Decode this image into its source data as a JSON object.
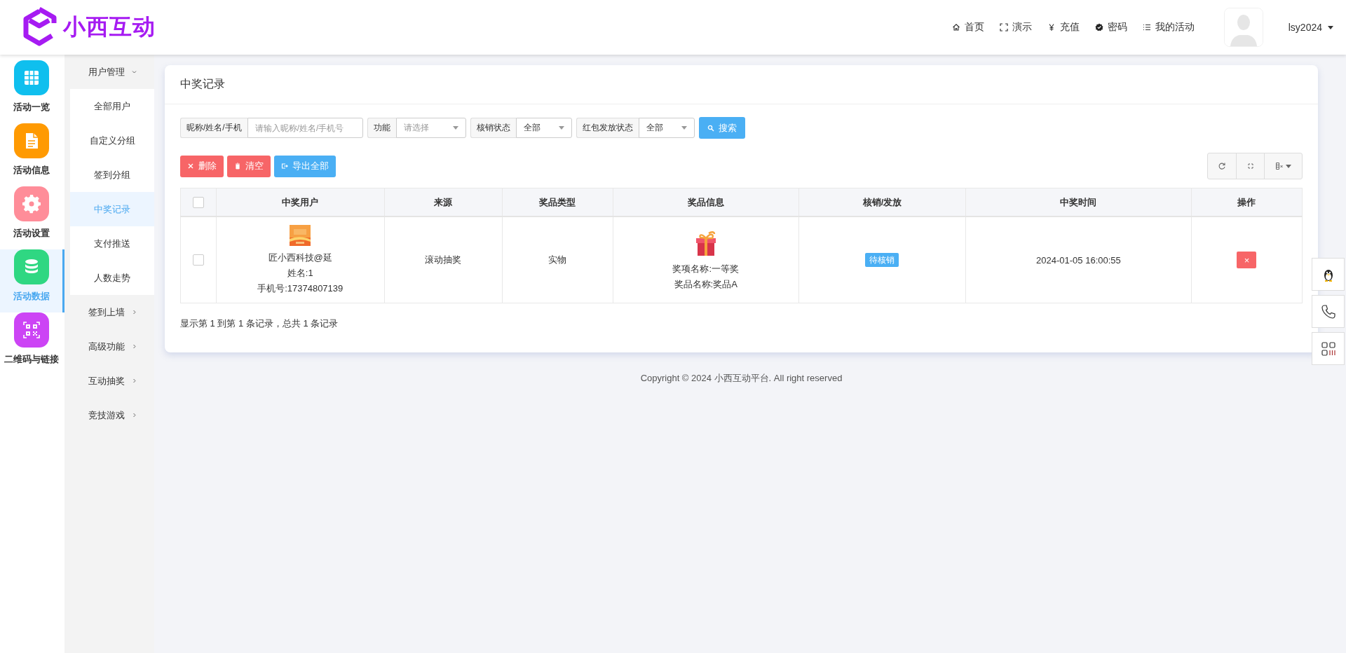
{
  "logo": {
    "text": "小西互动"
  },
  "nav": [
    {
      "kind": "home",
      "label": "首页"
    },
    {
      "kind": "expand",
      "label": "演示"
    },
    {
      "kind": "yen",
      "label": "充值"
    },
    {
      "kind": "badge",
      "label": "密码"
    },
    {
      "kind": "list",
      "label": "我的活动"
    }
  ],
  "user": {
    "name": "lsy2024"
  },
  "sidebar": {
    "items": [
      {
        "kind": "grid",
        "label": "活动一览",
        "color": "#0fbfee",
        "selected": false
      },
      {
        "kind": "doc",
        "label": "活动信息",
        "color": "#ff9a02",
        "selected": false
      },
      {
        "kind": "gear",
        "label": "活动设置",
        "color": "#ff8d99",
        "selected": false
      },
      {
        "kind": "db",
        "label": "活动数据",
        "color": "#2fd782",
        "selected": true
      },
      {
        "kind": "qr",
        "label": "二维码与链接",
        "color": "#cc44f5",
        "selected": false
      }
    ]
  },
  "submenu": [
    {
      "label": "用户管理",
      "expanded": true,
      "children": [
        {
          "label": "全部用户",
          "selected": false
        },
        {
          "label": "自定义分组",
          "selected": false
        },
        {
          "label": "签到分组",
          "selected": false
        },
        {
          "label": "中奖记录",
          "selected": true
        },
        {
          "label": "支付推送",
          "selected": false
        },
        {
          "label": "人数走势",
          "selected": false
        }
      ]
    },
    {
      "label": "签到上墙",
      "expanded": false
    },
    {
      "label": "高级功能",
      "expanded": false
    },
    {
      "label": "互动抽奖",
      "expanded": false
    },
    {
      "label": "竞技游戏",
      "expanded": false
    }
  ],
  "card": {
    "title": "中奖记录"
  },
  "filters": [
    {
      "kind": "text",
      "label": "昵称/姓名/手机",
      "placeholder": "请输入昵称/姓名/手机号"
    },
    {
      "kind": "select",
      "label": "功能",
      "placeholder": "请选择"
    },
    {
      "kind": "select",
      "label": "核销状态",
      "value": "全部"
    },
    {
      "kind": "select",
      "label": "红包发放状态",
      "value": "全部"
    }
  ],
  "search_button": "搜索",
  "actions": [
    {
      "kind": "delete",
      "label": "删除"
    },
    {
      "kind": "clear",
      "label": "清空"
    },
    {
      "kind": "export",
      "label": "导出全部"
    }
  ],
  "table": {
    "select_all": false,
    "columns": [
      "中奖用户",
      "来源",
      "奖品类型",
      "奖品信息",
      "核销/发放",
      "中奖时间",
      "操作"
    ],
    "rows": [
      {
        "checked": false,
        "user": {
          "name": "匠小西科技@延",
          "real_name": "姓名:1",
          "phone": "手机号:17374807139"
        },
        "source": "滚动抽奖",
        "prize_type": "实物",
        "prize": {
          "level": "奖项名称:一等奖",
          "name": "奖品名称:奖品A"
        },
        "status": "待核销",
        "time": "2024-01-05 16:00:55",
        "delete": "×"
      }
    ]
  },
  "pagination": "显示第 1 到第 1 条记录，总共 1 条记录",
  "copyright": "Copyright © 2024 小西互动平台. All right reserved"
}
